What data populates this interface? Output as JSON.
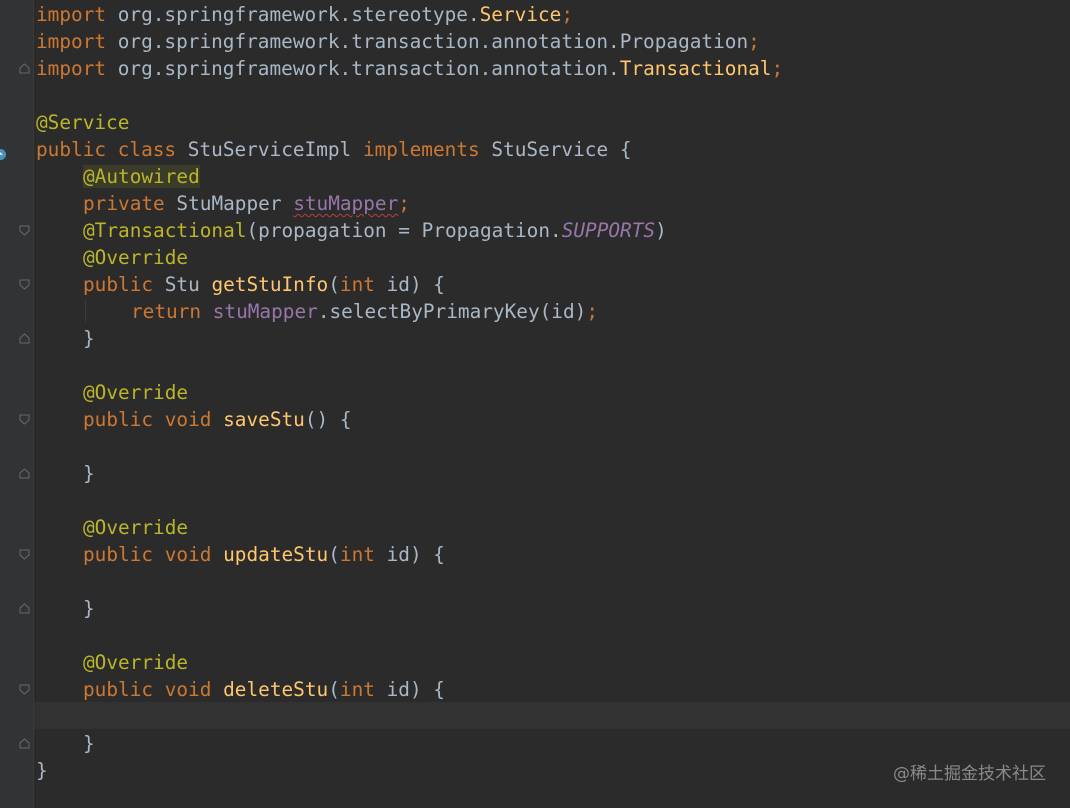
{
  "editor": {
    "lines": {
      "l1": {
        "kw": "import",
        "pkg": " org.springframework.stereotype.",
        "cls": "Service",
        "semi": ";"
      },
      "l2": {
        "kw": "import",
        "pkg": " org.springframework.transaction.annotation.Propagation",
        "semi": ";"
      },
      "l3": {
        "kw": "import",
        "pkg": " org.springframework.transaction.annotation.",
        "cls": "Transactional",
        "semi": ";"
      },
      "l5": {
        "ann": "@Service"
      },
      "l6": {
        "kw1": "public",
        "kw2": "class",
        "name": "StuServiceImpl",
        "kw3": "implements",
        "iface": "StuService",
        "brace": "{"
      },
      "l7": {
        "ann": "@Autowired"
      },
      "l8": {
        "kw": "private",
        "type": "StuMapper",
        "field": "stuMapper",
        "semi": ";"
      },
      "l9": {
        "ann": "@Transactional",
        "open": "(",
        "param": "propagation",
        "eq": " = ",
        "cls": "Propagation.",
        "const": "SUPPORTS",
        "close": ")"
      },
      "l10": {
        "ann": "@Override"
      },
      "l11": {
        "kw1": "public",
        "type": "Stu",
        "fn": "getStuInfo",
        "open": "(",
        "kw2": "int",
        "param": " id) {"
      },
      "l12": {
        "kw": "return",
        "field": "stuMapper",
        "call": ".selectByPrimaryKey(id)",
        "semi": ";"
      },
      "l13": {
        "brace": "}"
      },
      "l15": {
        "ann": "@Override"
      },
      "l16": {
        "kw1": "public",
        "kw2": "void",
        "fn": "saveStu",
        "rest": "() {"
      },
      "l18": {
        "brace": "}"
      },
      "l20": {
        "ann": "@Override"
      },
      "l21": {
        "kw1": "public",
        "kw2": "void",
        "fn": "updateStu",
        "open": "(",
        "kw3": "int",
        "rest": " id) {"
      },
      "l23": {
        "brace": "}"
      },
      "l25": {
        "ann": "@Override"
      },
      "l26": {
        "kw1": "public",
        "kw2": "void",
        "fn": "deleteStu",
        "open": "(",
        "kw3": "int",
        "rest": " id) {"
      },
      "l28": {
        "brace": "}"
      },
      "l29": {
        "brace": "}"
      }
    }
  },
  "watermark": "@稀土掘金技术社区",
  "colors": {
    "background": "#2b2b2b",
    "keyword": "#cc7832",
    "annotation": "#bbb529",
    "function": "#ffc66d",
    "field": "#9876aa",
    "text": "#a9b7c6"
  }
}
